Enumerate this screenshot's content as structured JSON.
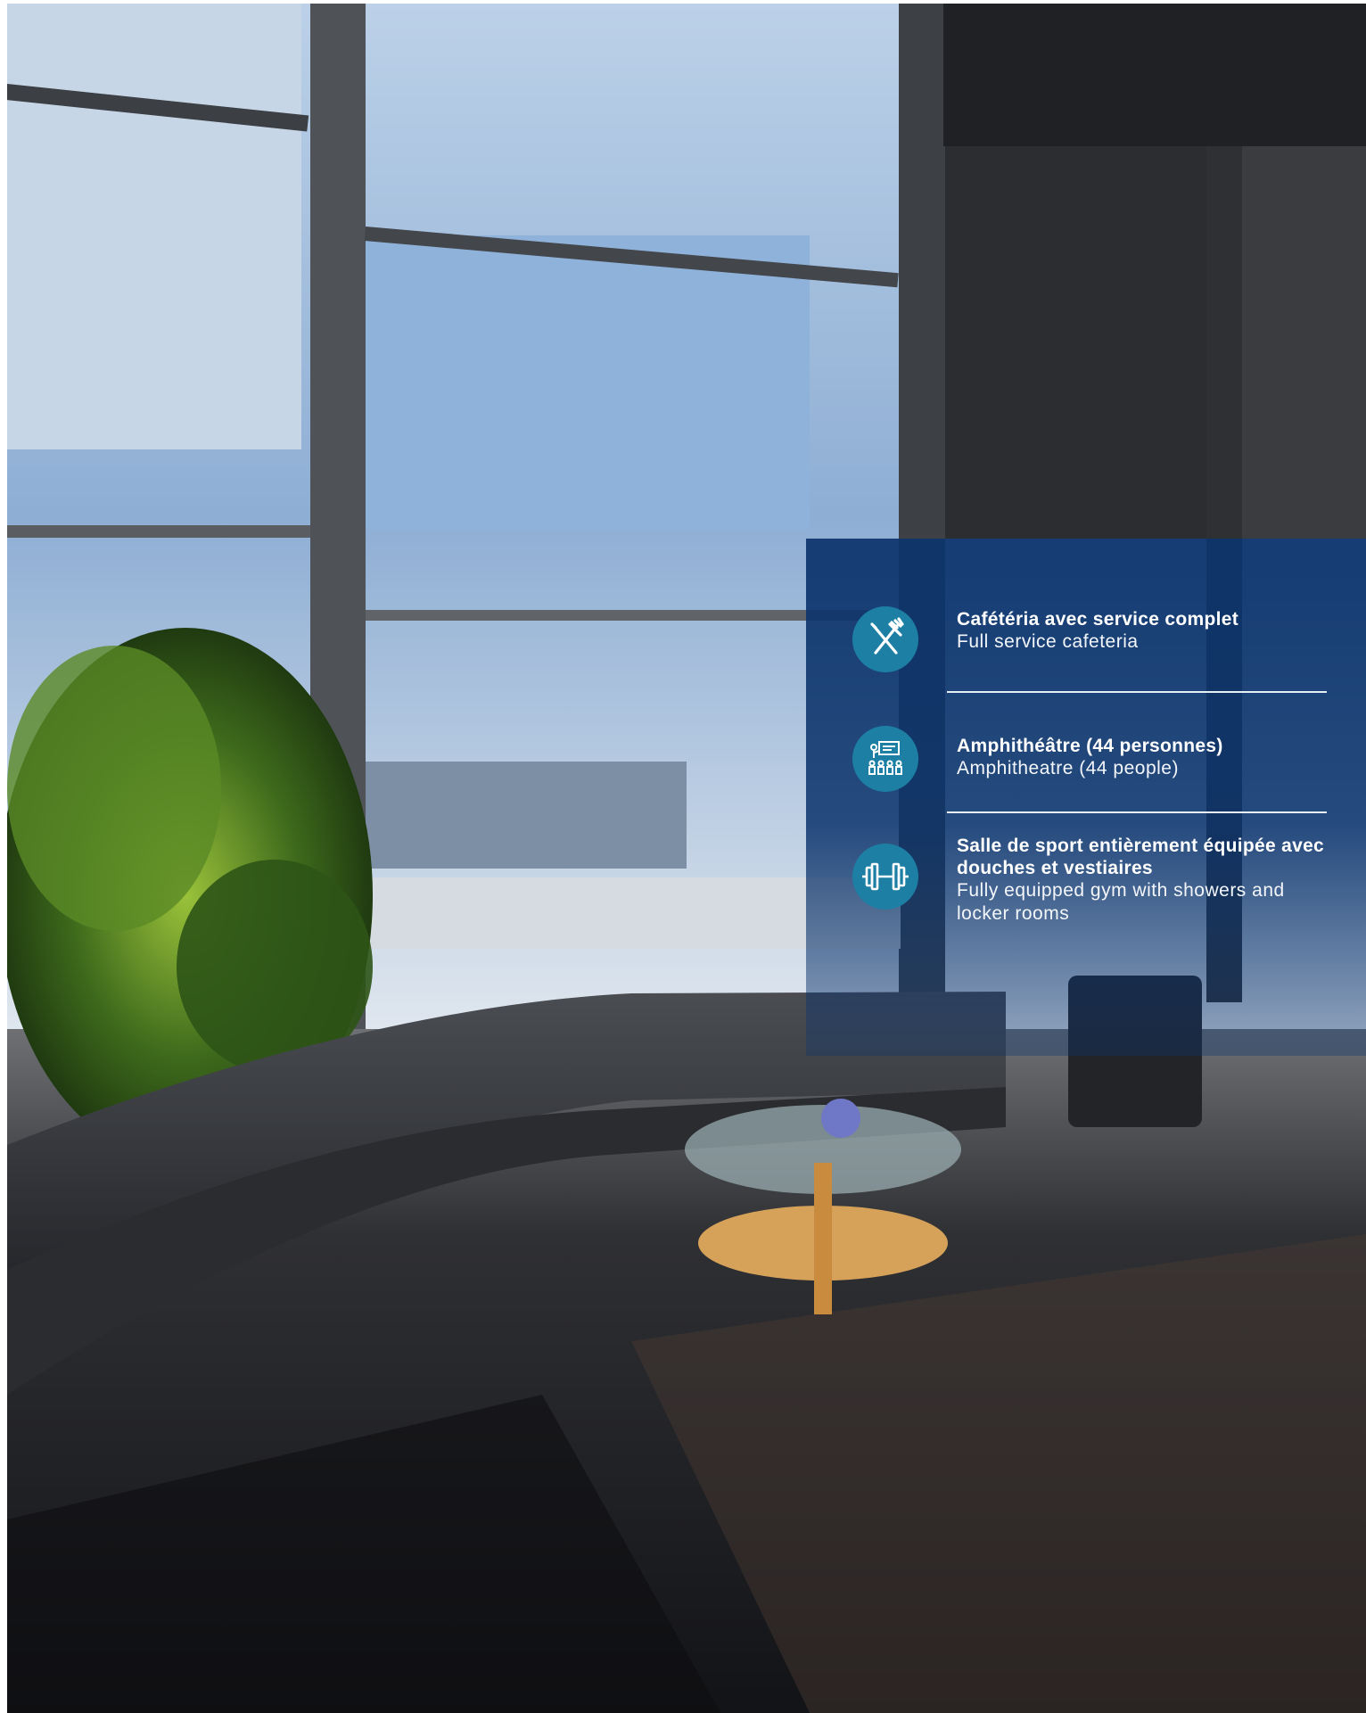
{
  "features": [
    {
      "icon": "utensils-icon",
      "title_fr": "Cafétéria avec service complet",
      "title_en": "Full service cafeteria"
    },
    {
      "icon": "amphitheatre-icon",
      "title_fr": "Amphithéâtre (44 personnes)",
      "title_en": "Amphitheatre (44 people)"
    },
    {
      "icon": "dumbbell-icon",
      "title_fr": "Salle de sport entièrement équipée avec douches et vestiaires",
      "title_en": "Fully equipped gym with showers and locker rooms"
    }
  ],
  "colors": {
    "panel": "#0c346c",
    "icon_circle": "#1e7fa5",
    "text": "#ffffff"
  }
}
